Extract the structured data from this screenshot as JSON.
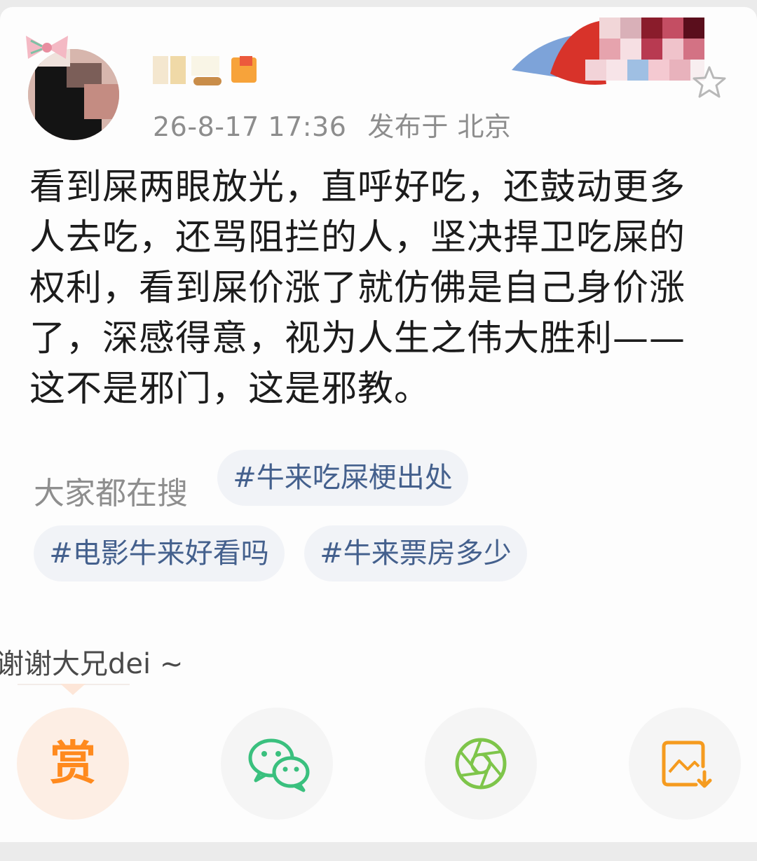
{
  "post": {
    "timestamp": "26-8-17 17:36",
    "location_label": "发布于 北京",
    "body_lines": [
      "看到屎两眼放光，直呼好吃，还鼓动更多",
      "人去吃，还骂阻拦的人，坚决捍卫吃屎的",
      "权利，看到屎价涨了就仿佛是自己身价涨",
      "了，深感得意，视为人生之伟大胜利——",
      "这不是邪门，这是邪教。"
    ]
  },
  "hot_search": {
    "label": "大家都在搜",
    "chips": [
      "#牛来吃屎梗出处",
      "#电影牛来好看吗",
      "#牛来票房多少"
    ]
  },
  "reward": {
    "thanks_text": "谢谢大兄dei ~",
    "reward_glyph": "赏"
  },
  "actions": {
    "icons": [
      "reward-icon",
      "wechat-icon",
      "moments-icon",
      "save-image-icon"
    ]
  },
  "colors": {
    "accent_orange": "#ff8a1e",
    "wechat_green": "#3ac07e",
    "moments_green": "#7ec54a",
    "chip_text": "#44608d"
  }
}
